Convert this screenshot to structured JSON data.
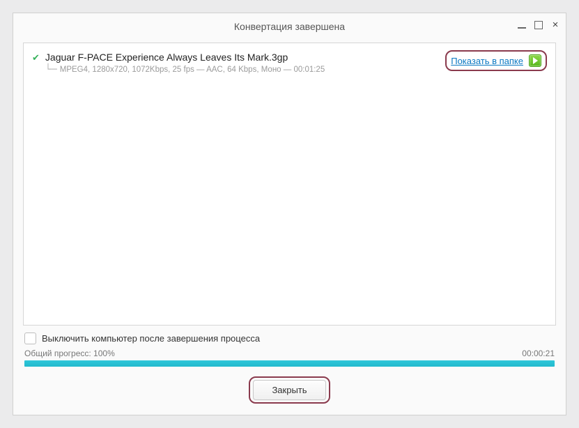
{
  "window": {
    "title": "Конвертация завершена"
  },
  "item": {
    "title": "Jaguar F-PACE Experience Always Leaves Its Mark.3gp",
    "meta": "MPEG4, 1280x720, 1072Kbps, 25 fps — AAC, 64 Kbps, Моно — 00:01:25",
    "show_in_folder": "Показать в папке"
  },
  "footer": {
    "shutdown": "Выключить компьютер после завершения процесса",
    "progress_label": "Общий прогресс: 100%",
    "elapsed": "00:00:21",
    "close": "Закрыть"
  }
}
